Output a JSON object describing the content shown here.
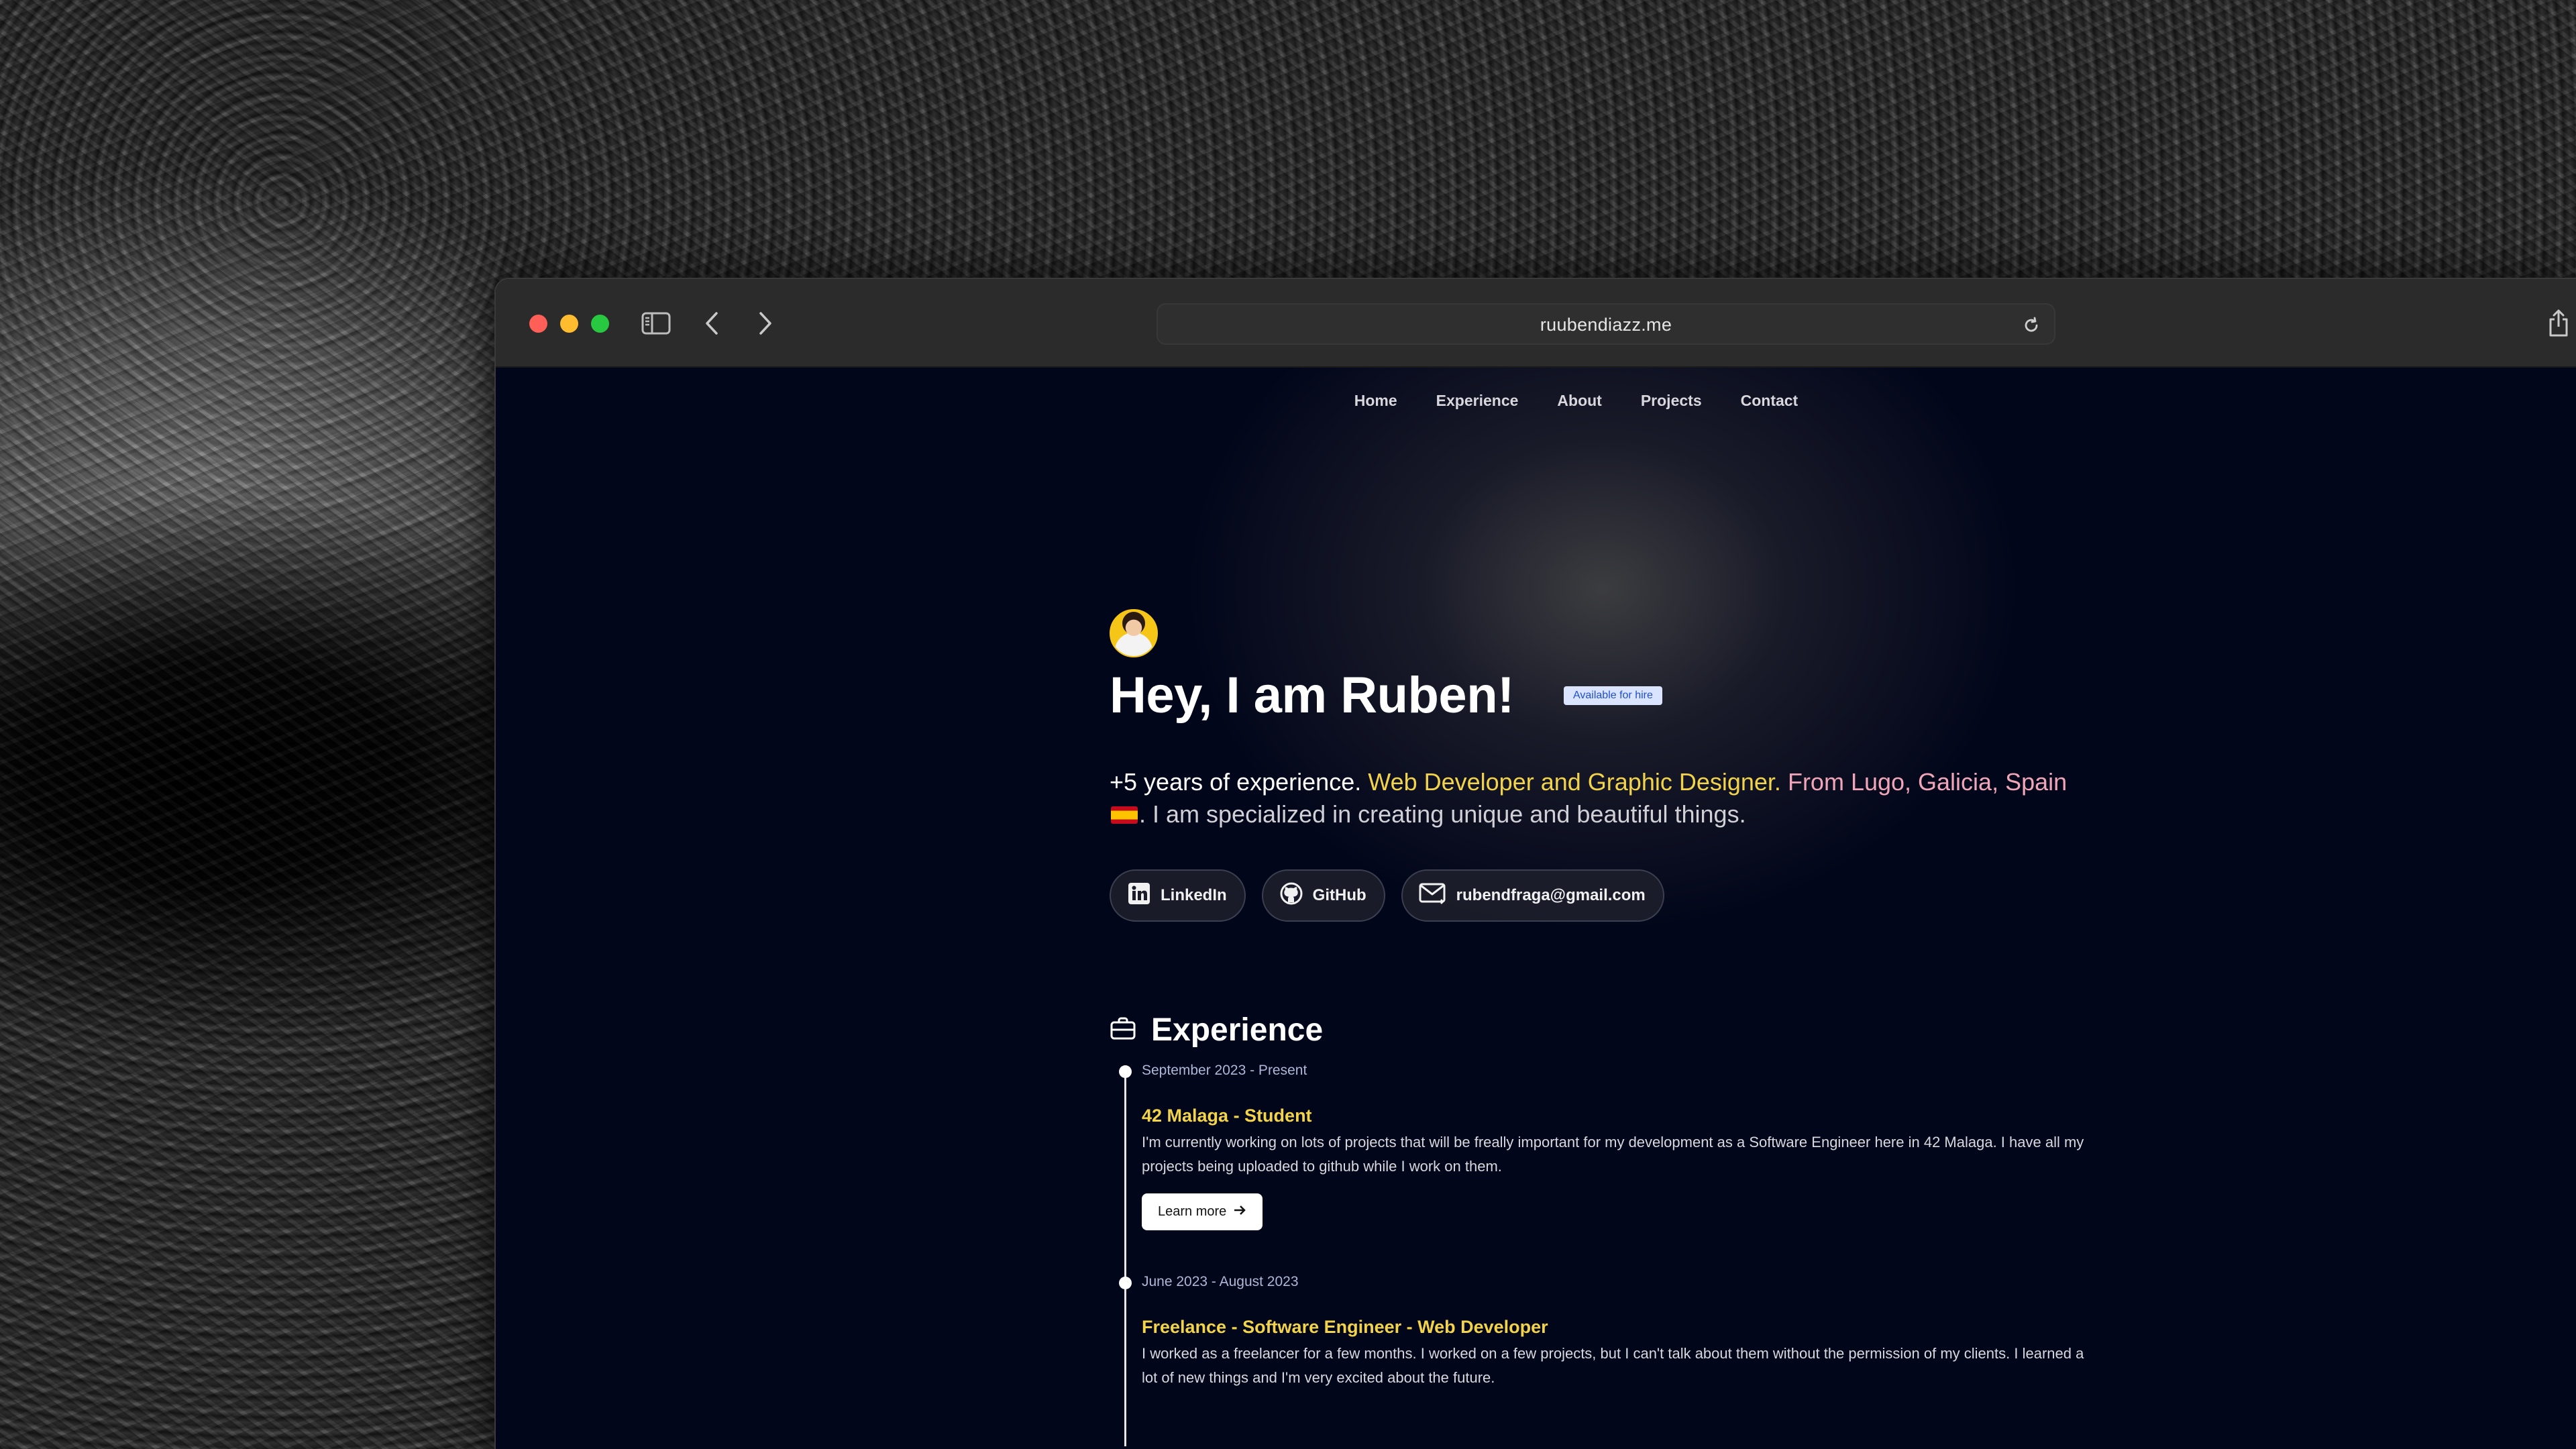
{
  "browser": {
    "url": "ruubendiazz.me"
  },
  "nav": {
    "items": [
      "Home",
      "Experience",
      "About",
      "Projects",
      "Contact"
    ]
  },
  "hero": {
    "title": "Hey, I am Ruben!",
    "badge": "Available for hire",
    "desc_part1": "+5 years of experience.",
    "desc_part2": "Web Developer and Graphic Designer.",
    "desc_part3": "From Lugo, Galicia, Spain",
    "desc_part4": ". I am specialized in creating unique and beautiful things.",
    "socials": [
      {
        "label": "LinkedIn",
        "icon": "linkedin-icon"
      },
      {
        "label": "GitHub",
        "icon": "github-icon"
      },
      {
        "label": "rubendfraga@gmail.com",
        "icon": "mail-icon"
      }
    ]
  },
  "experience": {
    "title": "Experience",
    "entries": [
      {
        "date": "September 2023 - Present",
        "role": "42 Malaga - Student",
        "description": "I'm currently working on lots of projects that will be freally important for my development as a Software Engineer here in 42 Malaga. I have all my projects being uploaded to github while I work on them.",
        "button": "Learn more"
      },
      {
        "date": "June 2023 - August 2023",
        "role": "Freelance - Software Engineer - Web Developer",
        "description": "I worked as a freelancer for a few months. I worked on a few projects, but I can't talk about them without the permission of my clients. I learned a lot of new things and I'm very excited about the future."
      }
    ]
  },
  "colors": {
    "accent_yellow": "#f3d34a",
    "accent_pink": "#f0a6b8",
    "page_bg": "#02061a"
  }
}
